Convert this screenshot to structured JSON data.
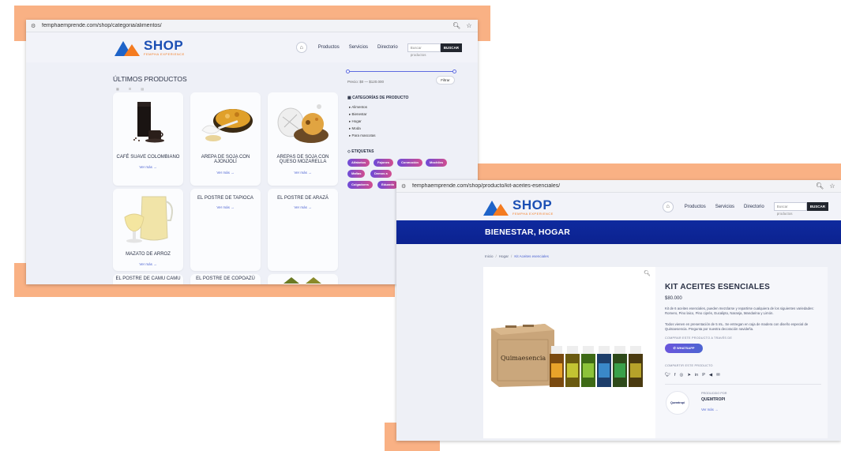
{
  "colors": {
    "accent": "#4d64d2",
    "frame": "#f9b184",
    "banner": "#0f2a9e",
    "tag_gradient_start": "#6d4ad8",
    "tag_gradient_end": "#d14d8f"
  },
  "window1": {
    "url": "femphaemprende.com/shop/categoria/alimentos/",
    "logo": {
      "title": "SHOP",
      "subtitle": "FEMPHA EXPERIENCE"
    },
    "nav": {
      "productos": "Productos",
      "servicios": "Servicios",
      "directorio": "Directorio"
    },
    "search": {
      "placeholder": "Buscar productos",
      "button": "BUSCAR"
    },
    "section_title": "ÚLTIMOS PRODUCTOS",
    "filter": {
      "price_text": "Precio: $0 — $120.000",
      "button": "Filtrar"
    },
    "categories": {
      "title": "CATEGORÍAS DE PRODUCTO",
      "items": [
        "Alimentos",
        "Bienestar",
        "Hogar",
        "Moda",
        "Para mascotas"
      ]
    },
    "tags": {
      "title": "ETIQUETAS",
      "items": [
        "Alfabetos",
        "Fajones",
        "Conmoción",
        "Mochiles",
        "Mafias",
        "Demos a",
        "Colgadores",
        "Eduardo"
      ]
    },
    "products": [
      {
        "name": "CAFÉ SUAVE COLOMBIANO",
        "more": "Ver más →"
      },
      {
        "name": "AREPA DE SOJA CON AJONJOLÍ",
        "more": "Ver más →"
      },
      {
        "name": "AREPAS DE SOJA CON QUESO MOZARELLA",
        "more": "Ver más →"
      },
      {
        "name": "MAZATO DE ARROZ",
        "more": "Ver más →"
      },
      {
        "name": "EL POSTRE DE TAPIOCA",
        "more": "Ver más →"
      },
      {
        "name": "EL POSTRE DE ARAZÁ",
        "more": "Ver más →"
      },
      {
        "name": "EL POSTRE DE CAMU CAMU",
        "more": ""
      },
      {
        "name": "EL POSTRE DE COPOAZÚ",
        "more": ""
      }
    ]
  },
  "window2": {
    "url": "femphaemprende.com/shop/producto/kit-aceites-esenciales/",
    "banner": "BIENESTAR, HOGAR",
    "breadcrumb": {
      "home": "Inicio",
      "category": "Hogar",
      "current": "Kit Aceites esenciales"
    },
    "product": {
      "title": "KIT ACEITES ESENCIALES",
      "price": "$80.000",
      "desc1": "Kit de 6 aceites esenciales, pueden mezclarse y repartirse cualquiera de los siguientes variedades: Romero, Pino laico, Pino ciprés, Eucalipto, Naranja, Mandarina y Limón.",
      "desc2": "Todos vienen en presentación de 5 mL. Se entregan en caja de madera con diseño especial de Quimaesencia. Pregunta por nuestra decoración navideña.",
      "buy_label": "COMPRAR ESTE PRODUCTO A TRAVÉS DE",
      "whatsapp": "WHATSAPP",
      "share_label": "COMPARTIR ESTE PRODUCTO",
      "producer_label": "PRODUCIDO POR",
      "producer_name": "QUEMTROPI",
      "producer_more": "Ver más →",
      "producer_logo_text": "Quemtropi",
      "box_text": "Quimaesencia"
    }
  }
}
